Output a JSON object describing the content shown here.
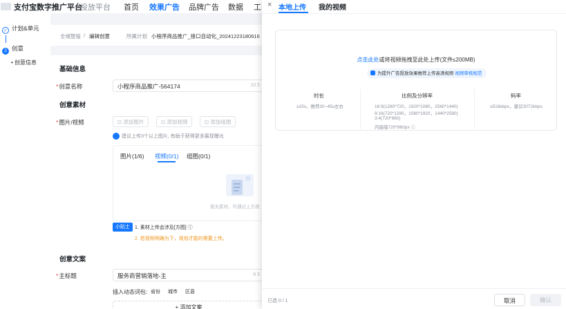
{
  "nav": {
    "brand": "支付宝数字推广平台",
    "brand_sub": "投放平台",
    "items": [
      "首页",
      "效果广告",
      "品牌广告",
      "数据",
      "工"
    ]
  },
  "steps": {
    "step1": "计划&单元",
    "step2": "创意",
    "step2_num": "2",
    "sub": "创意信息"
  },
  "breadcrumb": {
    "home": "全域智投",
    "sep": "/",
    "edit": "编辑创意",
    "plan_label": "所属计划",
    "plan_value": "小程序商品推广_接口自动化_20241223180616"
  },
  "form": {
    "basic_title": "基础信息",
    "name_label": "创意名称",
    "name_value": "小程序商品推广-564174",
    "name_counter": "10.5",
    "material_title": "创意素材",
    "media_label": "图片/视频",
    "btn_add_image": "添加图片",
    "btn_add_video": "添加视频",
    "btn_add_group": "添加组图",
    "tip": "建议上传3个以上图片, 有助于获得更多展现曝光",
    "tabs": [
      "图片(1/6)",
      "视频(0/1)",
      "组图(0/1)"
    ],
    "empty": "暂无素材，可通过上方按",
    "badge": "小贴士",
    "note1": "1. 素材上传会涉及[方图]",
    "note2": "2. 若视频明确为下，规划才能的需要上传。",
    "copy_title": "创意文案",
    "title_label": "主标题",
    "title_value": "服务商营销落地-主",
    "title_counter": "8.5",
    "insert_label": "插入动态词包:",
    "chips": [
      "省份",
      "城市",
      "区县"
    ],
    "add_copy": "+ 添加文案"
  },
  "drawer": {
    "close": "×",
    "tab_local": "本地上传",
    "tab_mine": "我的视频",
    "upload_link": "点击此处",
    "upload_text": "或将视频拖拽至此处上传(文件≤200MB)",
    "hint_text": "为提升广告投放效果推荐上传高清视频",
    "hint_link": "视频审核规范",
    "spec": {
      "duration_head": "时长",
      "duration_val": "≥15s，推荐30~45s左右",
      "ratio_head": "比例及分辨率",
      "ratio_vals": [
        "16:9(1280*720，1920*1080，2560*1440)",
        "9:16(720*1280，1080*1920，1440*2560)",
        "3:4(720*960)",
        "内嵌版720*960px"
      ],
      "bitrate_head": "码率",
      "bitrate_val": "≥516kbps，建议3072kbps"
    },
    "count": "已选 0 / 1",
    "cancel": "取消",
    "ok": "确认"
  }
}
